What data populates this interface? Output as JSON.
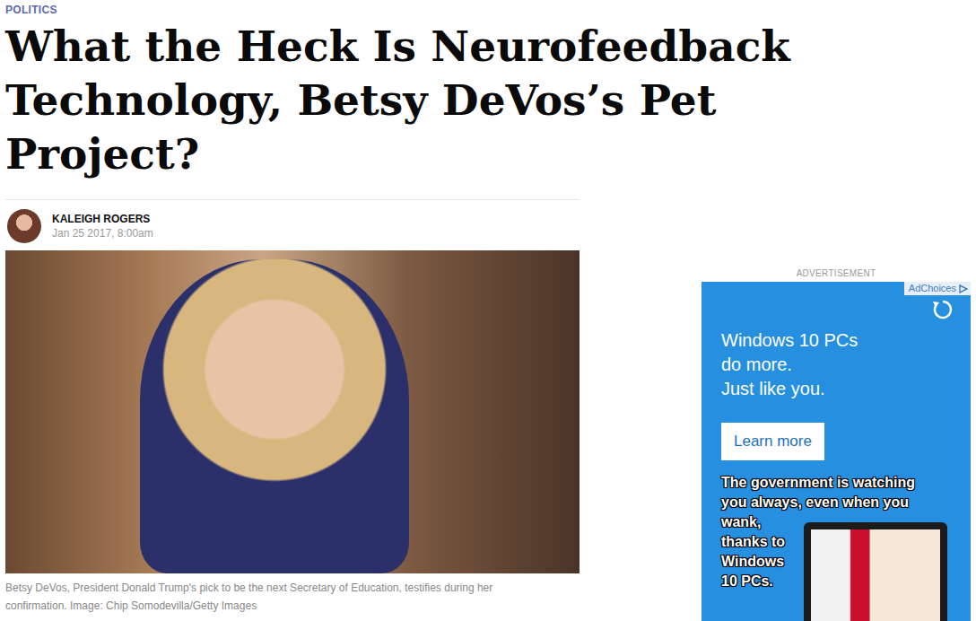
{
  "section": "POLITICS",
  "headline": [
    "What the Heck Is Neurofeedback",
    "Technology, Betsy DeVos’s Pet",
    "Project?"
  ],
  "author": {
    "name": "KALEIGH ROGERS",
    "date": "Jan 25 2017, 8:00am"
  },
  "photo": {
    "caption": [
      "Betsy DeVos, President Donald Trump's pick to be the next Secretary of Education, testifies during her",
      "confirmation. Image: Chip Somodevilla/Getty Images"
    ]
  },
  "ad": {
    "label": "ADVERTISEMENT",
    "adchoices": "AdChoices",
    "headline": [
      "Windows 10 PCs",
      "do more.",
      "Just like you."
    ],
    "button": "Learn more",
    "overlay": [
      "The government is watching",
      "you always, even when you",
      "wank,",
      "thanks to",
      "Windows",
      "10 PCs."
    ]
  }
}
